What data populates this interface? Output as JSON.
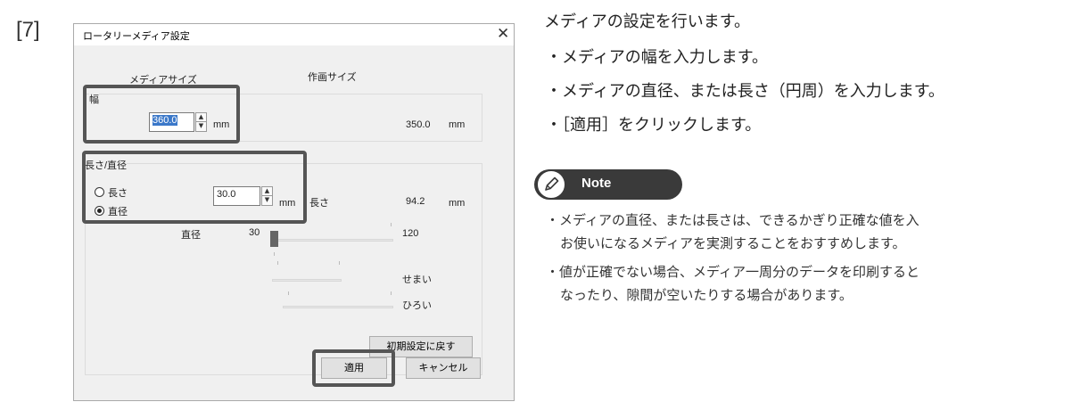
{
  "step_number": "[7]",
  "dialog": {
    "title": "ロータリーメディア設定",
    "close_glyph": "✕",
    "media_size_header": "メディアサイズ",
    "print_size_header": "作画サイズ",
    "width_group": {
      "label": "幅",
      "value": "360.0",
      "unit": "mm",
      "print_value": "350.0",
      "print_unit": "mm"
    },
    "length_group": {
      "label": "長さ/直径",
      "radio_length": "長さ",
      "radio_diameter": "直径",
      "selected": "直径",
      "value": "30.0",
      "unit": "mm",
      "print_label": "長さ",
      "print_value": "94.2",
      "print_unit": "mm"
    },
    "slider": {
      "label": "直径",
      "min": "30",
      "max": "120",
      "value": 30
    },
    "tightness": {
      "narrow_label": "せまい",
      "wide_label": "ひろい"
    },
    "reset_button": "初期設定に戻す",
    "apply_button": "適用",
    "cancel_button": "キャンセル"
  },
  "instructions": {
    "heading": "メディアの設定を行います。",
    "bullets": [
      "・メディアの幅を入力します。",
      "・メディアの直径、または長さ（円周）を入力します。",
      "・［適用］をクリックします。"
    ]
  },
  "note": {
    "label": "Note",
    "lines": [
      "・メディアの直径、または長さは、できるかぎり正確な値を入",
      "お使いになるメディアを実測することをおすすめします。",
      "・値が正確でない場合、メディア一周分のデータを印刷すると",
      "なったり、隙間が空いたりする場合があります。"
    ]
  }
}
